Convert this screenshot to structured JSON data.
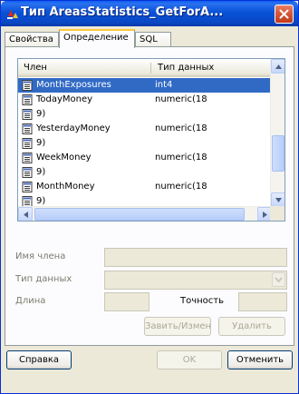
{
  "window": {
    "title": "Тип AreasStatistics_GetForA..."
  },
  "tabs": [
    {
      "label": "Свойства",
      "active": false
    },
    {
      "label": "Определение",
      "active": true
    },
    {
      "label": "SQL",
      "active": false
    }
  ],
  "members_list": {
    "columns": [
      "Член",
      "Тип данных"
    ],
    "rows": [
      {
        "name": "MonthExposures",
        "type": "int4",
        "selected": true
      },
      {
        "name": "TodayMoney",
        "type": "numeric(18",
        "selected": false
      },
      {
        "name": "9)",
        "type": "",
        "selected": false
      },
      {
        "name": "YesterdayMoney",
        "type": "numeric(18",
        "selected": false
      },
      {
        "name": "9)",
        "type": "",
        "selected": false
      },
      {
        "name": "WeekMoney",
        "type": "numeric(18",
        "selected": false
      },
      {
        "name": "9)",
        "type": "",
        "selected": false
      },
      {
        "name": "MonthMoney",
        "type": "numeric(18",
        "selected": false
      },
      {
        "name": "9)",
        "type": "",
        "selected": false
      }
    ]
  },
  "form": {
    "member_name_label": "Имя члена",
    "member_name_value": "",
    "data_type_label": "Тип данных",
    "data_type_value": "",
    "length_label": "Длина",
    "length_value": "",
    "precision_label": "Точность",
    "precision_value": "",
    "add_change_label": "Завить/Измен",
    "delete_label": "Удалить"
  },
  "footer": {
    "help_label": "Справка",
    "ok_label": "OK",
    "cancel_label": "Отменить"
  },
  "colors": {
    "selection": "#316ac5",
    "titlebar": "#0852d8",
    "tab_highlight": "#ffc83c"
  }
}
